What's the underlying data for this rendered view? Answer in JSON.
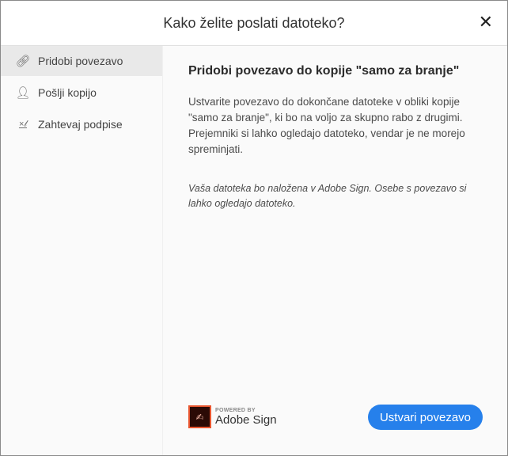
{
  "dialog": {
    "title": "Kako želite poslati datoteko?",
    "close_icon": "close-icon"
  },
  "sidebar": {
    "items": [
      {
        "label": "Pridobi povezavo",
        "icon": "link-icon"
      },
      {
        "label": "Pošlji kopijo",
        "icon": "add-user-icon"
      },
      {
        "label": "Zahtevaj podpise",
        "icon": "signature-icon"
      }
    ]
  },
  "main": {
    "heading": "Pridobi povezavo do kopije \"samo za branje\"",
    "description": "Ustvarite povezavo do dokončane datoteke v obliki kopije \"samo za branje\", ki bo na voljo za skupno rabo z drugimi. Prejemniki si lahko ogledajo datoteko, vendar je ne morejo spreminjati.",
    "note": "Vaša datoteka bo naložena v Adobe Sign. Osebe s povezavo si lahko ogledajo datoteko.",
    "powered_by": "POWERED BY",
    "brand": "Adobe Sign",
    "create_button": "Ustvari povezavo"
  },
  "colors": {
    "accent": "#2680eb"
  }
}
